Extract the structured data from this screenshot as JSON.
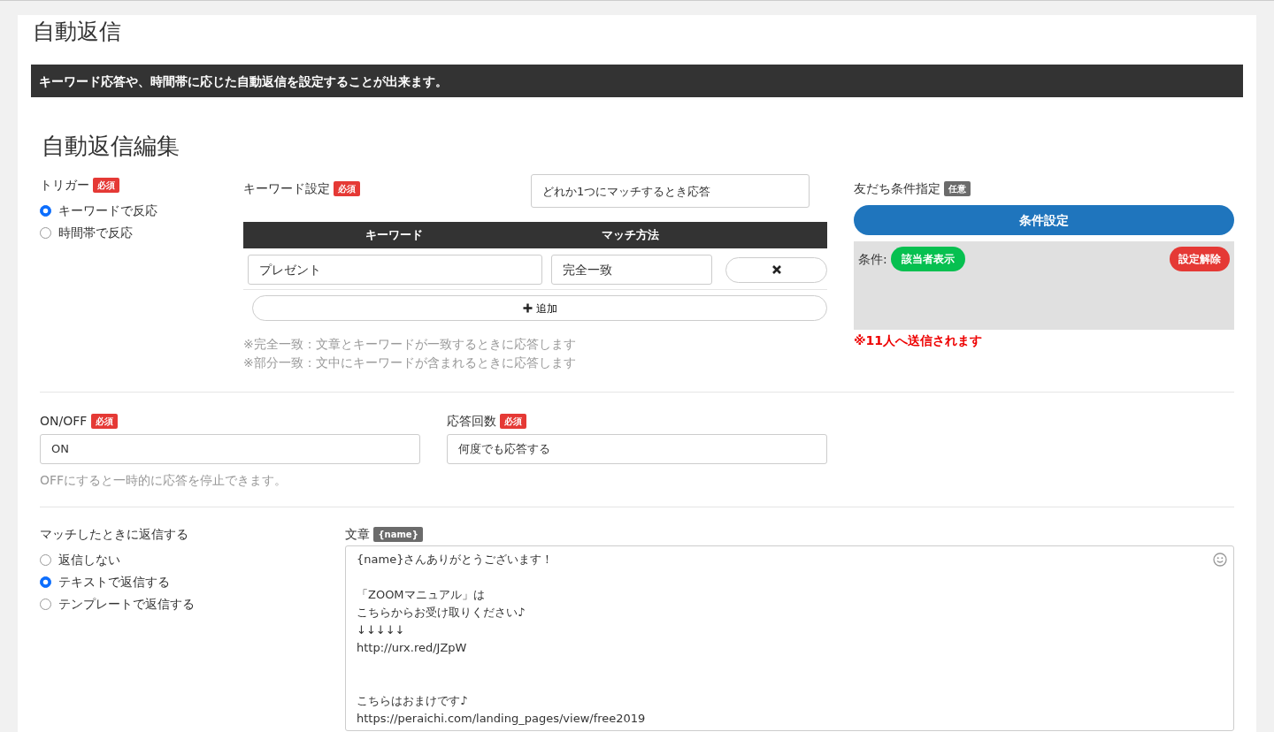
{
  "page_title": "自動返信",
  "info_banner": "キーワード応答や、時間帯に応じた自動返信を設定することが出来ます。",
  "section_title": "自動返信編集",
  "trigger": {
    "label": "トリガー",
    "badge": {
      "text": "必須",
      "kind": "required"
    },
    "options": [
      {
        "label": "キーワードで反応",
        "selected": true
      },
      {
        "label": "時間帯で反応",
        "selected": false
      }
    ]
  },
  "keyword_settings": {
    "label": "キーワード設定",
    "badge": {
      "text": "必須",
      "kind": "required"
    },
    "match_mode": "どれか1つにマッチするとき応答",
    "columns": [
      "キーワード",
      "マッチ方法"
    ],
    "rows": [
      {
        "keyword": "プレゼント",
        "method": "完全一致"
      }
    ],
    "add_button": "追加",
    "notes": [
      "※完全一致：文章とキーワードが一致するときに応答します",
      "※部分一致：文中にキーワードが含まれるときに応答します"
    ]
  },
  "friend_conditions": {
    "label": "友だち条件指定",
    "badge": {
      "text": "任意",
      "kind": "optional"
    },
    "set_button": "条件設定",
    "condition_label": "条件:",
    "show_button": "該当者表示",
    "clear_button": "設定解除",
    "recipients": "※11人へ送信されます"
  },
  "on_off": {
    "label": "ON/OFF",
    "badge": {
      "text": "必須",
      "kind": "required"
    },
    "value": "ON",
    "hint": "OFFにすると一時的に応答を停止できます。"
  },
  "reply_count": {
    "label": "応答回数",
    "badge": {
      "text": "必須",
      "kind": "required"
    },
    "value": "何度でも応答する"
  },
  "reply": {
    "label": "マッチしたときに返信する",
    "options": [
      {
        "label": "返信しない",
        "selected": false
      },
      {
        "label": "テキストで返信する",
        "selected": true
      },
      {
        "label": "テンプレートで返信する",
        "selected": false
      }
    ]
  },
  "message": {
    "label": "文章",
    "badge": {
      "text": "{name}",
      "kind": "variable"
    },
    "lines": [
      {
        "kind": "text",
        "text": "{name}さんありがとうございます！"
      },
      {
        "kind": "blank"
      },
      {
        "kind": "text",
        "text": "「ZOOMマニュアル」は"
      },
      {
        "kind": "text",
        "text": "こちらからお受け取りください♪"
      },
      {
        "kind": "text",
        "text": "↓↓↓↓↓"
      },
      {
        "kind": "text",
        "text": "http://urx.red/JZpW"
      },
      {
        "kind": "blank"
      },
      {
        "kind": "blank"
      },
      {
        "kind": "text",
        "text": "こちらはおまけです♪"
      },
      {
        "kind": "text",
        "text": "https://peraichi.com/landing_pages/view/free2019"
      }
    ]
  }
}
